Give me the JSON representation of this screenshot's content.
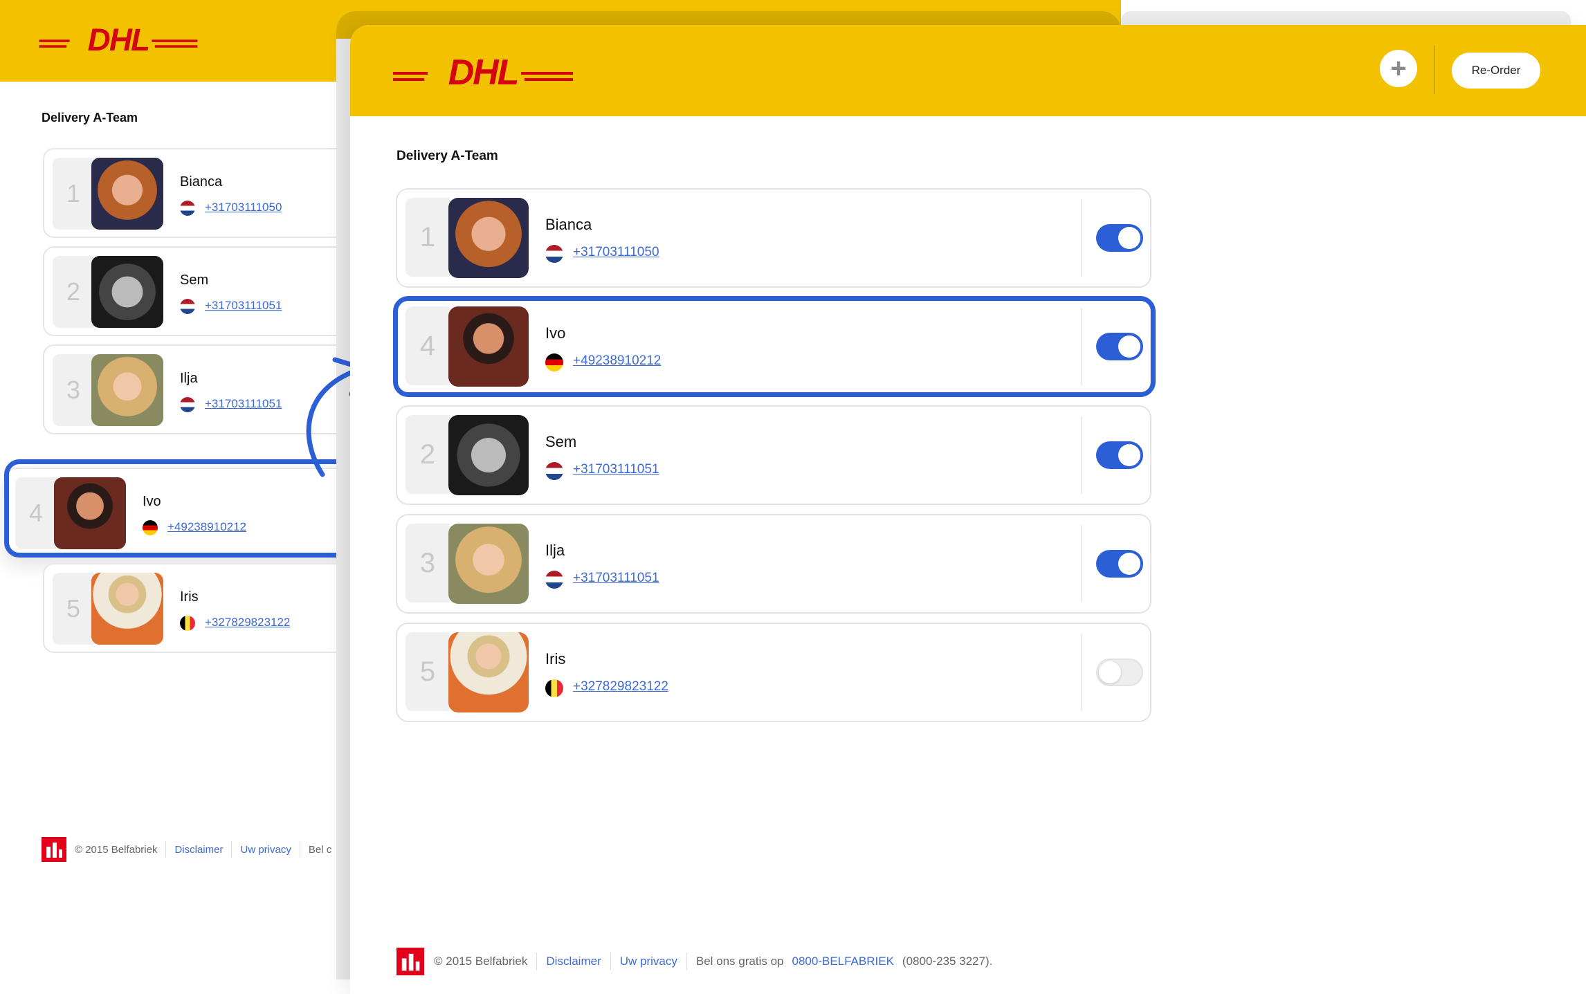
{
  "brand": {
    "logo_text": "DHL",
    "logo_color": "#d40511",
    "header_color": "#f2c200",
    "accent_color": "#2c5fd6"
  },
  "back_window": {
    "team_title": "Delivery A-Team",
    "members": [
      {
        "position": "1",
        "name": "Bianca",
        "country": "NL",
        "phone": "+31703111050"
      },
      {
        "position": "2",
        "name": "Sem",
        "country": "NL",
        "phone": "+31703111051"
      },
      {
        "position": "3",
        "name": "Ilja",
        "country": "NL",
        "phone": "+31703111051"
      },
      {
        "position": "4",
        "name": "Ivo",
        "country": "DE",
        "phone": "+49238910212"
      },
      {
        "position": "5",
        "name": "Iris",
        "country": "BE",
        "phone": "+327829823122"
      }
    ],
    "footer": {
      "copyright": "© 2015 Belfabriek",
      "disclaimer": "Disclaimer",
      "privacy": "Uw privacy",
      "truncated": "Bel c"
    }
  },
  "front_window": {
    "add_icon": "plus-icon",
    "reorder_label": "Re-Order",
    "team_title": "Delivery A-Team",
    "members": [
      {
        "position": "1",
        "name": "Bianca",
        "country": "NL",
        "phone": "+31703111050",
        "enabled": true
      },
      {
        "position": "4",
        "name": "Ivo",
        "country": "DE",
        "phone": "+49238910212",
        "enabled": true
      },
      {
        "position": "2",
        "name": "Sem",
        "country": "NL",
        "phone": "+31703111051",
        "enabled": true
      },
      {
        "position": "3",
        "name": "Ilja",
        "country": "NL",
        "phone": "+31703111051",
        "enabled": true
      },
      {
        "position": "5",
        "name": "Iris",
        "country": "BE",
        "phone": "+327829823122",
        "enabled": false
      }
    ],
    "footer": {
      "copyright": "© 2015 Belfabriek",
      "disclaimer": "Disclaimer",
      "privacy": "Uw privacy",
      "call_prefix": "Bel ons gratis op",
      "hotline": "0800-BELFABRIEK",
      "hotline_number": "(0800-235 3227)."
    }
  }
}
